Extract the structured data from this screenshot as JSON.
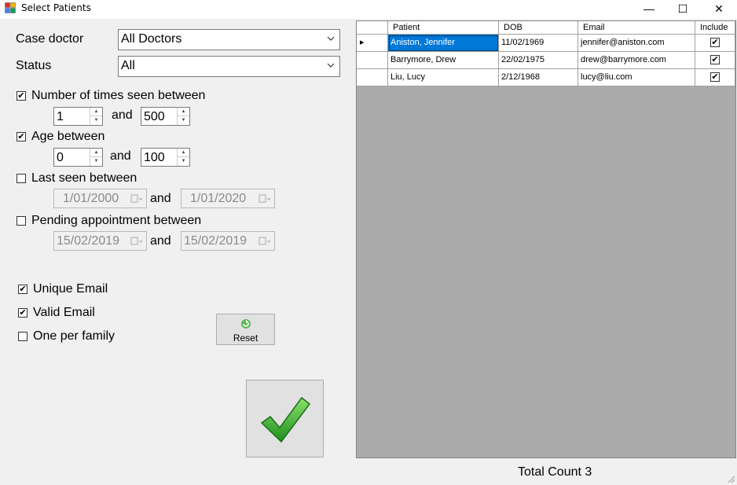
{
  "window": {
    "title": "Select Patients",
    "minimize_glyph": "—",
    "maximize_glyph": "☐",
    "close_glyph": "✕"
  },
  "filters": {
    "case_doctor": {
      "label": "Case doctor",
      "value": "All Doctors"
    },
    "status": {
      "label": "Status",
      "value": "All"
    },
    "times_seen": {
      "label": "Number of times seen between",
      "checked": true,
      "from": "1",
      "to": "500",
      "and_label": "and"
    },
    "age": {
      "label": "Age between",
      "checked": true,
      "from": "0",
      "to": "100",
      "and_label": "and"
    },
    "last_seen": {
      "label": "Last seen between",
      "checked": false,
      "from": "1/01/2000",
      "to": "1/01/2020",
      "and_label": "and"
    },
    "pending_appointment": {
      "label": "Pending appointment between",
      "checked": false,
      "from": "15/02/2019",
      "to": "15/02/2019",
      "and_label": "and"
    },
    "unique_email": {
      "label": "Unique Email",
      "checked": true
    },
    "valid_email": {
      "label": "Valid Email",
      "checked": true
    },
    "one_per_family": {
      "label": "One per family",
      "checked": false
    }
  },
  "check_glyph": "✔",
  "reset_button": {
    "label": "Reset",
    "icon": "refresh-icon"
  },
  "ok_button": {
    "icon": "checkmark-icon"
  },
  "grid": {
    "columns": [
      "Patient",
      "DOB",
      "Email",
      "Include"
    ],
    "current_row_glyph": "▸",
    "rows": [
      {
        "patient": "Aniston, Jennifer",
        "dob": "11/02/1969",
        "email": "jennifer@aniston.com",
        "include": true,
        "selected": true
      },
      {
        "patient": "Barrymore, Drew",
        "dob": "22/02/1975",
        "email": "drew@barrymore.com",
        "include": true,
        "selected": false
      },
      {
        "patient": "Liu, Lucy",
        "dob": "2/12/1968",
        "email": "lucy@liu.com",
        "include": true,
        "selected": false
      }
    ]
  },
  "total_count": "Total Count 3"
}
